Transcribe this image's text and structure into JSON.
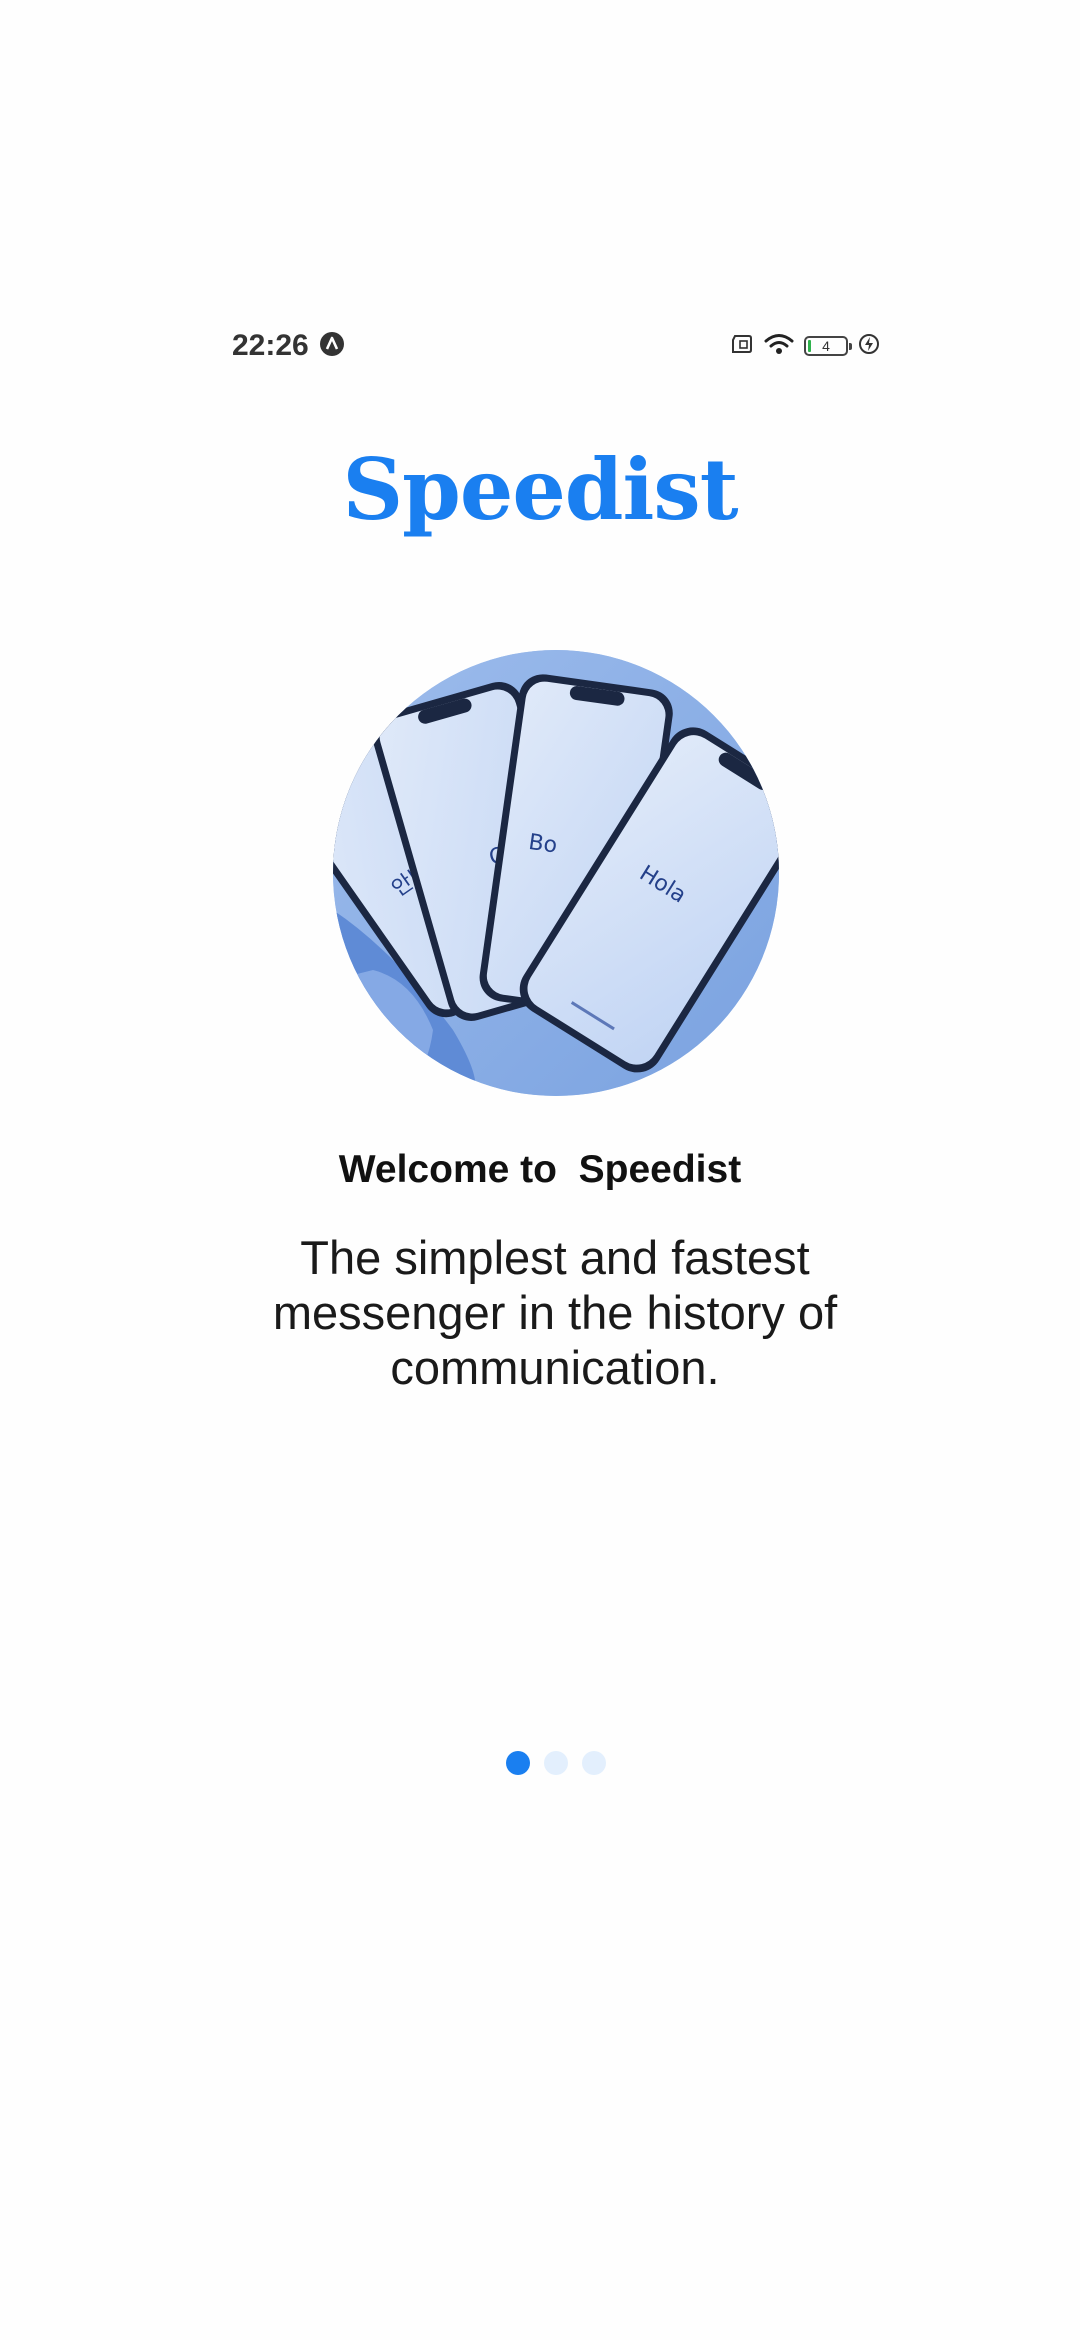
{
  "status_bar": {
    "time": "22:26",
    "battery_level": "4",
    "icons": [
      "notification-a-icon",
      "sim-icon",
      "wifi-icon",
      "battery-icon",
      "charging-icon"
    ]
  },
  "app": {
    "logo_text": "Speedist",
    "brand_color": "#1a7ff0"
  },
  "onboarding": {
    "title": "Welcome to  Speedist",
    "description": "The simplest and fastest messenger in the history of communication.",
    "hero_greetings": [
      "안녕하",
      "Olá",
      "Bo",
      "Hola"
    ],
    "pager": {
      "total": 3,
      "active_index": 0
    }
  }
}
